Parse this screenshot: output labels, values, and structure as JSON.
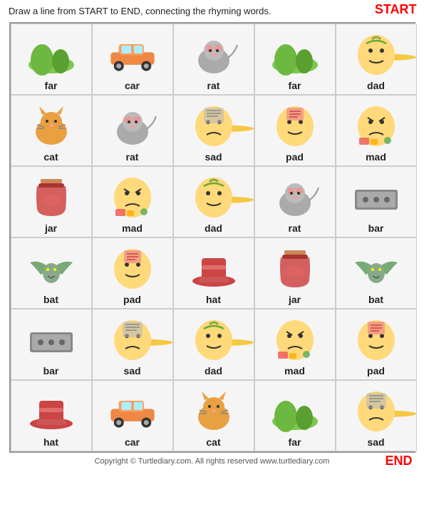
{
  "instructions": "Draw a line from START to END, connecting the rhyming words.",
  "start_label": "START",
  "end_label": "END",
  "footer": "Copyright © Turtlediary.com. All rights reserved   www.turtlediary.com",
  "grid": [
    [
      {
        "label": "far",
        "icon": "hill",
        "path": false,
        "circle": false
      },
      {
        "label": "car",
        "icon": "car",
        "path": false,
        "circle": false
      },
      {
        "label": "rat",
        "icon": "mouse",
        "path": false,
        "circle": false
      },
      {
        "label": "far",
        "icon": "hill",
        "path": false,
        "circle": false
      },
      {
        "label": "dad",
        "icon": "dad",
        "path": true,
        "circle": true,
        "start": true
      }
    ],
    [
      {
        "label": "cat",
        "icon": "cat",
        "path": false,
        "circle": false
      },
      {
        "label": "rat",
        "icon": "mouse",
        "path": false,
        "circle": false
      },
      {
        "label": "sad",
        "icon": "sad",
        "path": true,
        "circle": true
      },
      {
        "label": "pad",
        "icon": "pad",
        "path": true,
        "circle": false
      },
      {
        "label": "mad",
        "icon": "mad",
        "path": true,
        "circle": false
      }
    ],
    [
      {
        "label": "jar",
        "icon": "jar",
        "path": false,
        "circle": false
      },
      {
        "label": "mad",
        "icon": "mad",
        "path": true,
        "circle": false
      },
      {
        "label": "dad",
        "icon": "dad",
        "path": true,
        "circle": true
      },
      {
        "label": "rat",
        "icon": "mouse",
        "path": false,
        "circle": false
      },
      {
        "label": "bar",
        "icon": "bar",
        "path": false,
        "circle": false
      }
    ],
    [
      {
        "label": "bat",
        "icon": "bat",
        "path": false,
        "circle": false
      },
      {
        "label": "pad",
        "icon": "pad",
        "path": true,
        "circle": false
      },
      {
        "label": "hat",
        "icon": "hat",
        "path": false,
        "circle": false
      },
      {
        "label": "jar",
        "icon": "jar",
        "path": false,
        "circle": false
      },
      {
        "label": "bat",
        "icon": "bat",
        "path": false,
        "circle": false
      }
    ],
    [
      {
        "label": "bar",
        "icon": "bar",
        "path": false,
        "circle": false
      },
      {
        "label": "sad",
        "icon": "sad",
        "path": true,
        "circle": true
      },
      {
        "label": "dad",
        "icon": "dad",
        "path": true,
        "circle": true
      },
      {
        "label": "mad",
        "icon": "mad",
        "path": true,
        "circle": false
      },
      {
        "label": "pad",
        "icon": "pad",
        "path": true,
        "circle": false,
        "end_approach": true
      }
    ],
    [
      {
        "label": "hat",
        "icon": "hat",
        "path": false,
        "circle": false
      },
      {
        "label": "car",
        "icon": "car",
        "path": false,
        "circle": false
      },
      {
        "label": "cat",
        "icon": "cat",
        "path": false,
        "circle": false
      },
      {
        "label": "far",
        "icon": "hill",
        "path": false,
        "circle": false
      },
      {
        "label": "sad",
        "icon": "sad",
        "path": true,
        "circle": true,
        "end": true
      }
    ]
  ]
}
